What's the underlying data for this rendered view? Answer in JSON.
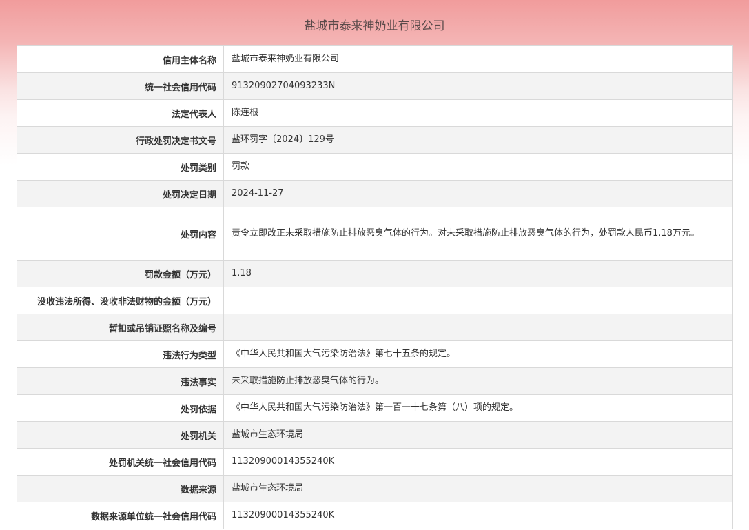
{
  "header": {
    "title": "盐城市泰来神奶业有限公司"
  },
  "rows": [
    {
      "label": "信用主体名称",
      "value": "盐城市泰来神奶业有限公司"
    },
    {
      "label": "统一社会信用代码",
      "value": "91320902704093233N"
    },
    {
      "label": "法定代表人",
      "value": "陈连根"
    },
    {
      "label": "行政处罚决定书文号",
      "value": "盐环罚字〔2024〕129号"
    },
    {
      "label": "处罚类别",
      "value": "罚款"
    },
    {
      "label": "处罚决定日期",
      "value": "2024-11-27"
    },
    {
      "label": "处罚内容",
      "value": "责令立即改正未采取措施防止排放恶臭气体的行为。对未采取措施防止排放恶臭气体的行为，处罚款人民币1.18万元。"
    },
    {
      "label": "罚款金额（万元）",
      "value": "1.18"
    },
    {
      "label": "没收违法所得、没收非法财物的金额（万元）",
      "value": "— —"
    },
    {
      "label": "暂扣或吊销证照名称及编号",
      "value": "— —"
    },
    {
      "label": "违法行为类型",
      "value": "《中华人民共和国大气污染防治法》第七十五条的规定。"
    },
    {
      "label": "违法事实",
      "value": "未采取措施防止排放恶臭气体的行为。"
    },
    {
      "label": "处罚依据",
      "value": "《中华人民共和国大气污染防治法》第一百一十七条第（八）项的规定。"
    },
    {
      "label": "处罚机关",
      "value": "盐城市生态环境局"
    },
    {
      "label": "处罚机关统一社会信用代码",
      "value": "11320900014355240K"
    },
    {
      "label": "数据来源",
      "value": "盐城市生态环境局"
    },
    {
      "label": "数据来源单位统一社会信用代码",
      "value": "11320900014355240K"
    }
  ]
}
